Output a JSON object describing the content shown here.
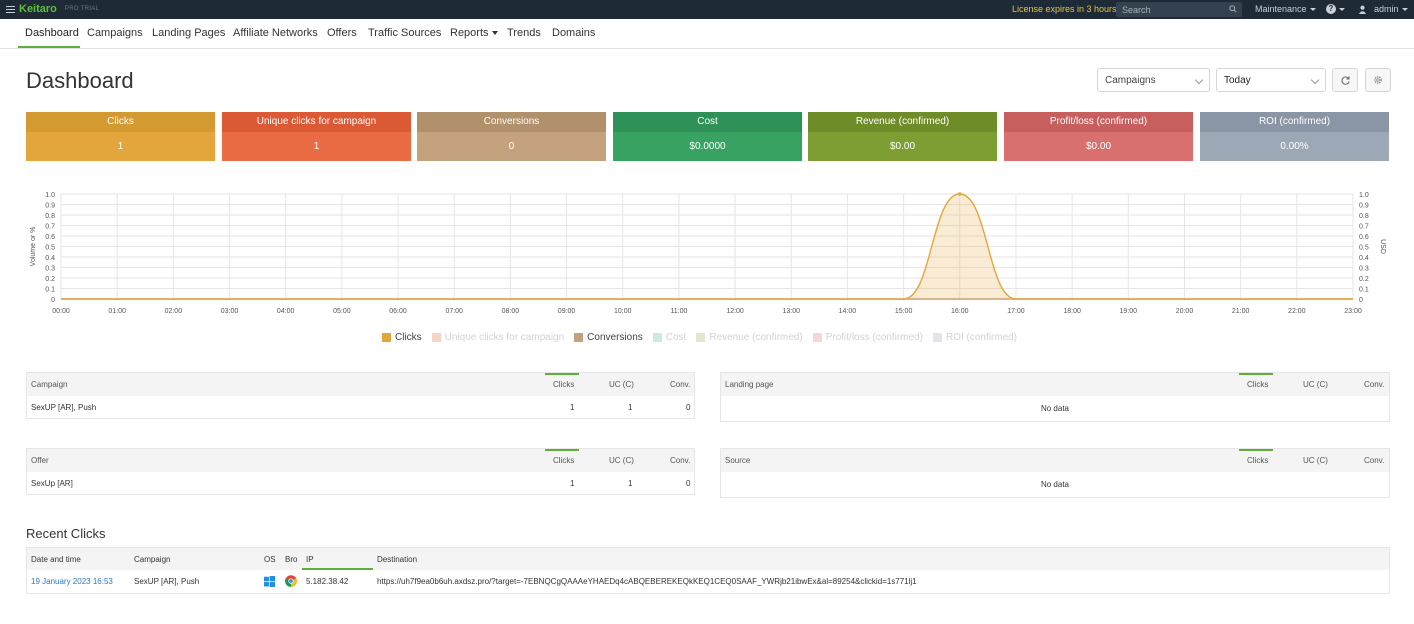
{
  "topbar": {
    "brand": "Keitaro",
    "edition": "PRO TRIAL",
    "license": "License expires in 3 hours",
    "search_placeholder": "Search",
    "maintenance": "Maintenance",
    "help": "?",
    "user": "admin"
  },
  "nav": {
    "items": [
      "Dashboard",
      "Campaigns",
      "Landing Pages",
      "Affiliate Networks",
      "Offers",
      "Traffic Sources",
      "Reports",
      "Trends",
      "Domains"
    ]
  },
  "page": {
    "title": "Dashboard",
    "filter_group": "Campaigns",
    "filter_period": "Today"
  },
  "metrics": [
    {
      "label": "Clicks",
      "value": "1",
      "head_color": "#d39a32",
      "body_color": "#e3a63d"
    },
    {
      "label": "Unique clicks for campaign",
      "value": "1",
      "head_color": "#db5a35",
      "body_color": "#ea6c45"
    },
    {
      "label": "Conversions",
      "value": "0",
      "head_color": "#b0916c",
      "body_color": "#c4a27d"
    },
    {
      "label": "Cost",
      "value": "$0.0000",
      "head_color": "#2e9157",
      "body_color": "#38a263"
    },
    {
      "label": "Revenue (confirmed)",
      "value": "$0.00",
      "head_color": "#6e8c28",
      "body_color": "#7e9e33"
    },
    {
      "label": "Profit/loss (confirmed)",
      "value": "$0.00",
      "head_color": "#c85f5f",
      "body_color": "#d87070"
    },
    {
      "label": "ROI (confirmed)",
      "value": "0.00%",
      "head_color": "#8a96a6",
      "body_color": "#9da8b6"
    }
  ],
  "chart_data": {
    "type": "area",
    "ylabel": "Volume or %",
    "y2label": "USD",
    "ylim": [
      0,
      1
    ],
    "y_ticks": [
      "0",
      "0.1",
      "0.2",
      "0.3",
      "0.4",
      "0.5",
      "0.6",
      "0.7",
      "0.8",
      "0.9",
      "1.0"
    ],
    "x": [
      "00:00",
      "01:00",
      "02:00",
      "03:00",
      "04:00",
      "05:00",
      "06:00",
      "07:00",
      "08:00",
      "09:00",
      "10:00",
      "11:00",
      "12:00",
      "13:00",
      "14:00",
      "15:00",
      "16:00",
      "17:00",
      "18:00",
      "19:00",
      "20:00",
      "21:00",
      "22:00",
      "23:00"
    ],
    "grid": true,
    "legend_position": "bottom",
    "series": [
      {
        "name": "Clicks",
        "color": "#e3a63d",
        "active": true,
        "values": [
          0,
          0,
          0,
          0,
          0,
          0,
          0,
          0,
          0,
          0,
          0,
          0,
          0,
          0,
          0,
          0,
          1,
          0,
          0,
          0,
          0,
          0,
          0,
          0
        ]
      },
      {
        "name": "Unique clicks for campaign",
        "color": "#f6d5c6",
        "active": false
      },
      {
        "name": "Conversions",
        "color": "#c4a27d",
        "active": true,
        "values": [
          0,
          0,
          0,
          0,
          0,
          0,
          0,
          0,
          0,
          0,
          0,
          0,
          0,
          0,
          0,
          0,
          0,
          0,
          0,
          0,
          0,
          0,
          0,
          0
        ]
      },
      {
        "name": "Cost",
        "color": "#cfe8da",
        "active": false
      },
      {
        "name": "Revenue (confirmed)",
        "color": "#e0e8cf",
        "active": false
      },
      {
        "name": "Profit/loss (confirmed)",
        "color": "#f2d7d7",
        "active": false
      },
      {
        "name": "ROI (confirmed)",
        "color": "#e2e5ea",
        "active": false
      }
    ]
  },
  "tables": {
    "campaign": {
      "header": "Campaign",
      "cols": [
        "Clicks",
        "UC (C)",
        "Conv."
      ],
      "rows": [
        {
          "name": "SexUP [AR], Push",
          "clicks": "1",
          "uc": "1",
          "conv": "0"
        }
      ]
    },
    "landing": {
      "header": "Landing page",
      "cols": [
        "Clicks",
        "UC (C)",
        "Conv."
      ],
      "empty": "No data"
    },
    "offer": {
      "header": "Offer",
      "cols": [
        "Clicks",
        "UC (C)",
        "Conv."
      ],
      "rows": [
        {
          "name": "SexUp [AR]",
          "clicks": "1",
          "uc": "1",
          "conv": "0"
        }
      ]
    },
    "source": {
      "header": "Source",
      "cols": [
        "Clicks",
        "UC (C)",
        "Conv."
      ],
      "empty": "No data"
    }
  },
  "recent": {
    "title": "Recent Clicks",
    "cols": [
      "Date and time",
      "Campaign",
      "OS",
      "Bro",
      "IP",
      "Destination"
    ],
    "rows": [
      {
        "date": "19 January 2023 16:53",
        "campaign": "SexUP [AR], Push",
        "os_icon": "windows-icon",
        "browser_icon": "chrome-icon",
        "ip": "5.182.38.42",
        "destination": "https://uh7f9ea0b6uh.axdsz.pro/?target=-7EBNQCgQAAAeYHAEDq4cABQEBEREKEQkKEQ1CEQ0SAAF_YWRjb21ibwEx&al=89254&clickid=1s771lj1"
      }
    ]
  }
}
